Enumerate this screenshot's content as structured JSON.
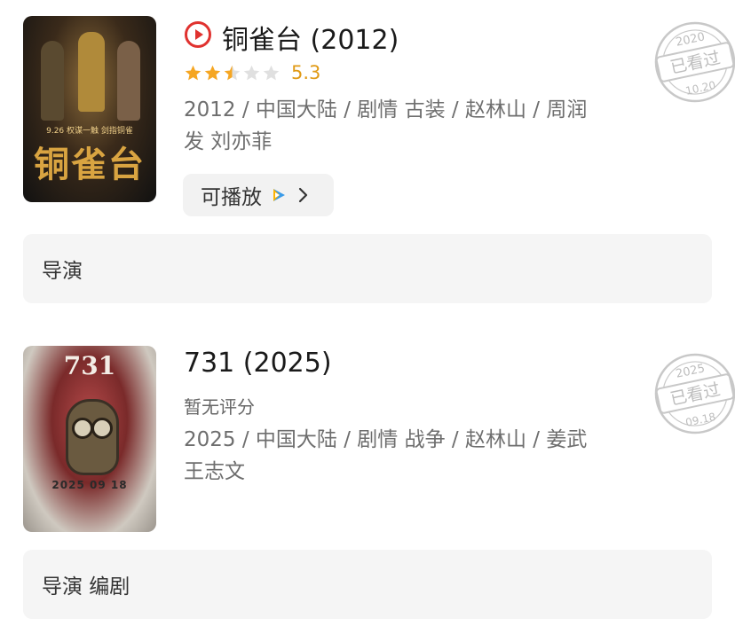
{
  "movies": [
    {
      "title": "铜雀台 (2012)",
      "poster_title": "铜雀台",
      "poster_tagline": "9.26 权谋一触 剑指铜雀",
      "rating": 2.5,
      "score": "5.3",
      "info": "2012 / 中国大陆 / 剧情 古装 / 赵林山 / 周润发 刘亦菲",
      "play_label": "可播放",
      "credits": "导演",
      "stamp": {
        "year": "2020",
        "label": "已看过",
        "date": "10.20"
      }
    },
    {
      "title": "731 (2025)",
      "poster_title": "731",
      "poster_date": "2025 09 18",
      "rating_text": "暂无评分",
      "info": "2025 / 中国大陆 / 剧情 战争 / 赵林山 / 姜武 王志文",
      "credits": "导演 编剧",
      "stamp": {
        "year": "2025",
        "label": "已看过",
        "date": "09.18"
      }
    }
  ],
  "colors": {
    "star": "#f5a623",
    "star_empty": "#e0e0e0",
    "score": "#e09a15",
    "play_icon": "#e0322f",
    "stamp": "#c8c8c8"
  },
  "icons": [
    "play-circle-icon",
    "star-icon",
    "tencent-video-icon",
    "chevron-right-icon",
    "watched-stamp-icon"
  ]
}
